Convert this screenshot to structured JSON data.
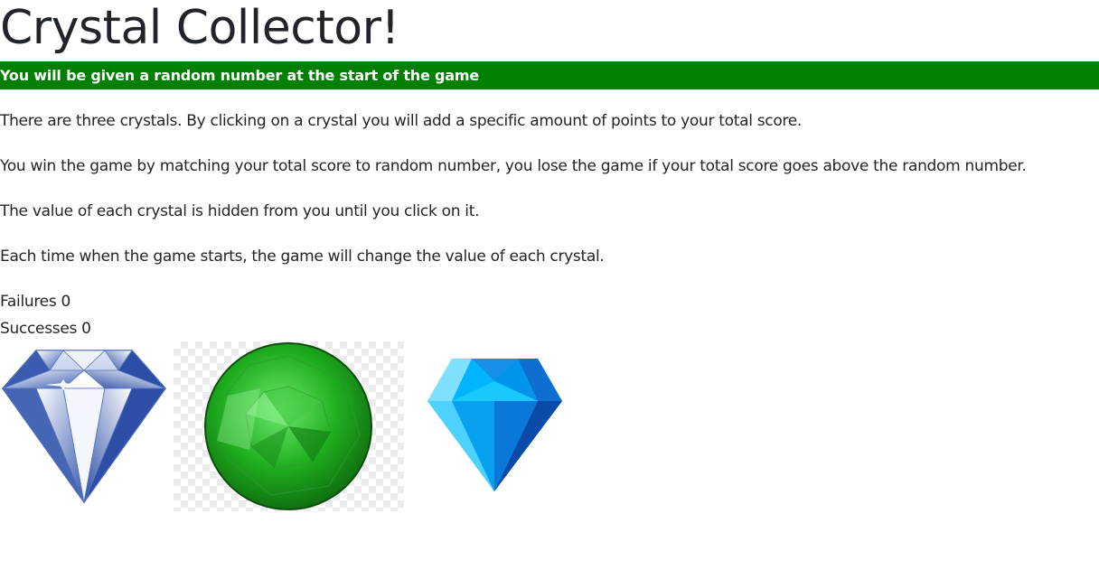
{
  "header": {
    "title": "Crystal Collector!"
  },
  "banner": {
    "text": "You will be given a random number at the start of the game",
    "color": "#008000"
  },
  "instructions": [
    "There are three crystals. By clicking on a crystal you will add a specific amount of points to your total score.",
    "You win the game by matching your total score to random number, you lose the game if your total score goes above the random number.",
    "The value of each crystal is hidden from you until you click on it.",
    "Each time when the game starts, the game will change the value of each crystal."
  ],
  "scoreboard": {
    "failures_label": "Failures",
    "failures": 0,
    "successes_label": "Successes",
    "successes": 0
  },
  "crystals": [
    {
      "icon": "white-diamond-icon",
      "color": "#3f5fb0"
    },
    {
      "icon": "green-emerald-icon",
      "color": "#1fae1f"
    },
    {
      "icon": "blue-gem-icon",
      "color": "#00a8f0"
    }
  ]
}
